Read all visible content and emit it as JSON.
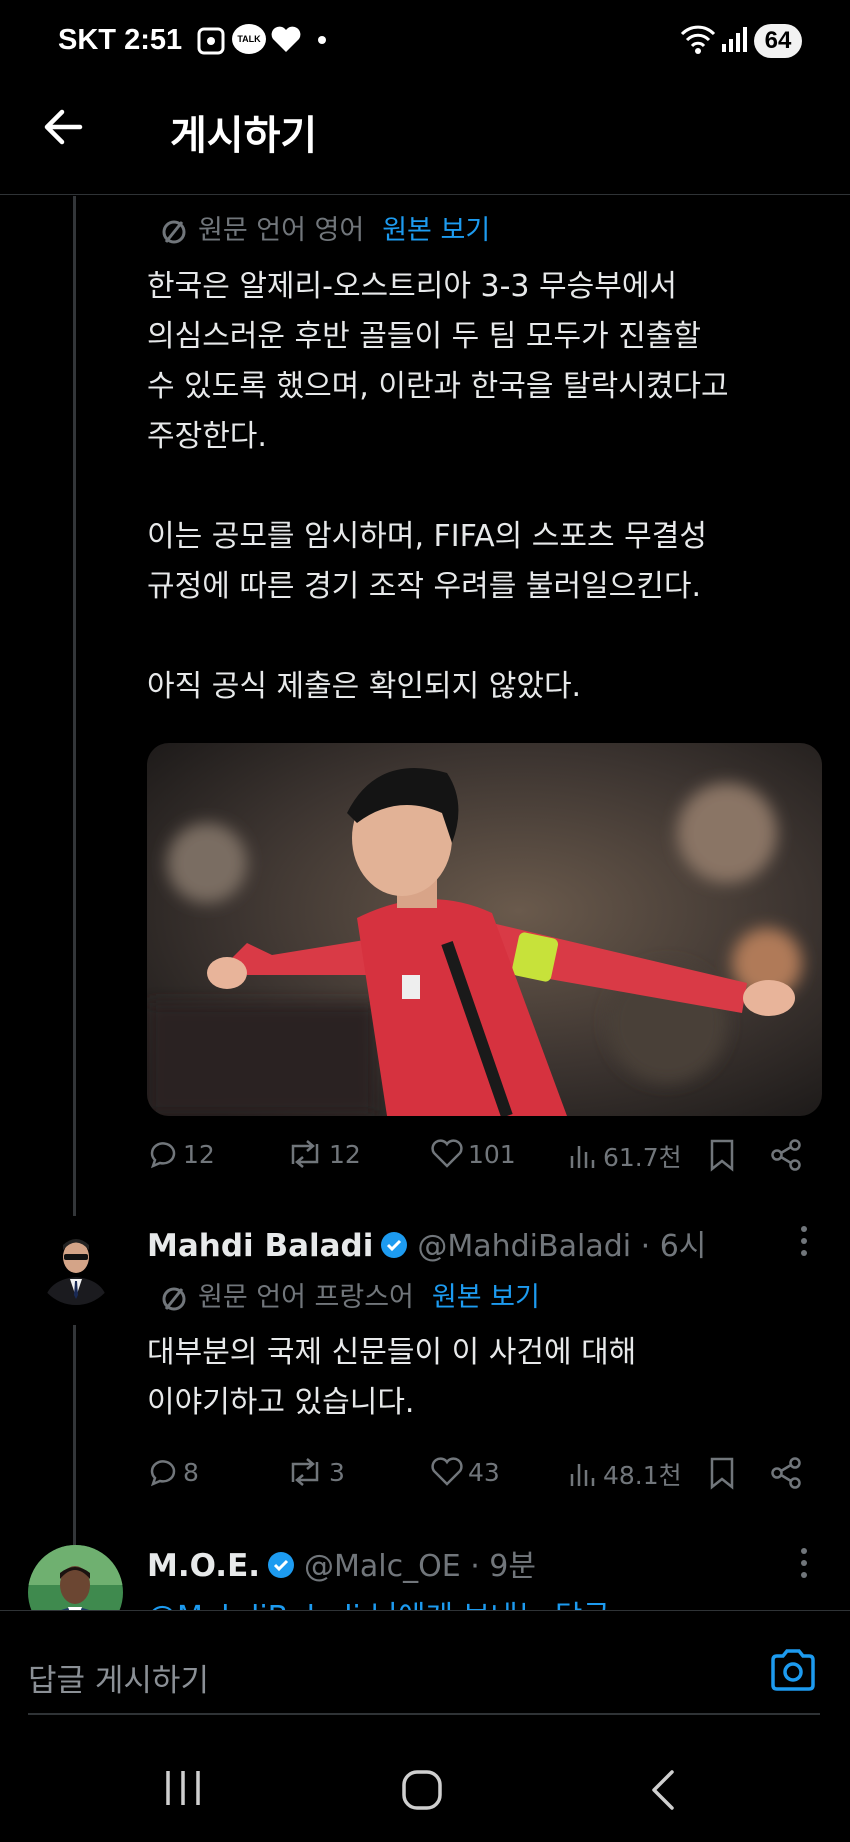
{
  "status_bar": {
    "carrier": "SKT",
    "time": "2:51",
    "talk_badge": "TALK",
    "battery": "64"
  },
  "header": {
    "title": "게시하기"
  },
  "post": {
    "translate_label": "원문 언어 영어",
    "translate_link": "원본 보기",
    "text": "한국은 알제리-오스트리아 3-3 무승부에서\n의심스러운 후반 골들이 두 팀 모두가 진출할\n수 있도록 했으며, 이란과 한국을 탈락시켰다고\n주장한다.\n\n이는 공모를 암시하며, FIFA의 스포츠 무결성\n규정에 따른 경기 조작 우려를 불러일으킨다.\n\n아직 공식 제출은 확인되지 않았다.",
    "replies": "12",
    "reposts": "12",
    "likes": "101",
    "views": "61.7천"
  },
  "reply1": {
    "name": "Mahdi Baladi",
    "handle": "@MahdiBaladi · 6시",
    "translate_label": "원문 언어 프랑스어",
    "translate_link": "원본 보기",
    "text": "대부분의 국제 신문들이 이 사건에 대해\n이야기하고 있습니다.",
    "replies": "8",
    "reposts": "3",
    "likes": "43",
    "views": "48.1천"
  },
  "reply2": {
    "name": "M.O.E.",
    "handle": "@Malc_OE · 9분",
    "text_partial": "@MahdiBaladi 님에게 보내는 답글"
  },
  "reply_bar": {
    "placeholder": "답글 게시하기"
  },
  "colors": {
    "accent": "#1d9bf0",
    "muted": "#71767b",
    "text": "#e7e9ea",
    "background": "#000000"
  }
}
